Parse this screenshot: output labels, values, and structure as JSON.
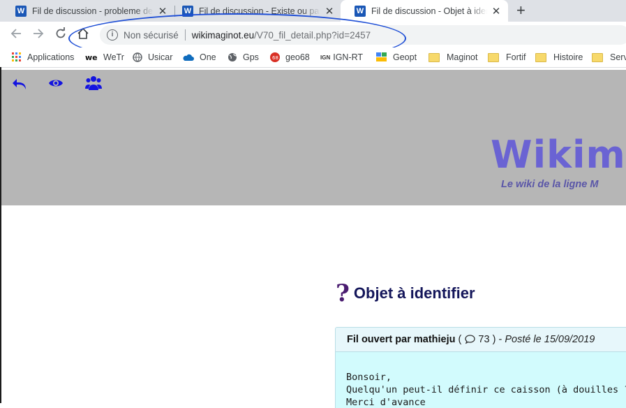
{
  "browser": {
    "tabs": [
      {
        "title": "Fil de discussion - probleme de c",
        "icon": "word-icon"
      },
      {
        "title": "Fil de discussion - Existe ou pas ?",
        "icon": "word-icon"
      },
      {
        "title": "Fil de discussion - Objet à identif",
        "icon": "word-icon",
        "active": true
      }
    ],
    "word_letter": "W",
    "close_glyph": "✕",
    "new_tab_glyph": "+",
    "address": {
      "security_label": "Non sécurisé",
      "host": "wikimaginot.eu",
      "path": "/V70_fil_detail.php?id=2457"
    },
    "bookmarks": [
      {
        "label": "Applications",
        "icon": "apps-grid-icon"
      },
      {
        "label": "WeTr",
        "icon": "wetransfer-icon"
      },
      {
        "label": "Usicar",
        "icon": "globe-icon"
      },
      {
        "label": "One",
        "icon": "onedrive-icon"
      },
      {
        "label": "Gps",
        "icon": "globe-icon"
      },
      {
        "label": "geo68",
        "icon": "geo68-icon"
      },
      {
        "label": "IGN-RT",
        "icon": "ign-icon",
        "prefix": "IGN"
      },
      {
        "label": "Geopt",
        "icon": "geoportail-icon"
      },
      {
        "label": "Maginot",
        "icon": "folder-icon"
      },
      {
        "label": "Fortif",
        "icon": "folder-icon"
      },
      {
        "label": "Histoire",
        "icon": "folder-icon"
      },
      {
        "label": "Serv-",
        "icon": "folder-icon"
      }
    ],
    "annotation_color": "#1f4fd6"
  },
  "site": {
    "brand": "Wikima",
    "tagline": "Le wiki de la ligne M",
    "header_color": "#b6b6b6",
    "brand_color": "#6a63d3",
    "header_icons": [
      "back-arrow-icon",
      "eye-icon",
      "users-icon"
    ]
  },
  "thread": {
    "title_mark": "?",
    "title": "Objet à identifier",
    "opened_by_label": "Fil ouvert par mathieju",
    "paren_open": "(",
    "replies_count": "73",
    "paren_close": ")",
    "separator": "-",
    "posted": "Posté le 15/09/2019",
    "body_lines": [
      "Bonsoir,",
      "Quelqu'un peut-il définir ce caisson (à douilles ?) récupér",
      "Merci d'avance"
    ]
  }
}
